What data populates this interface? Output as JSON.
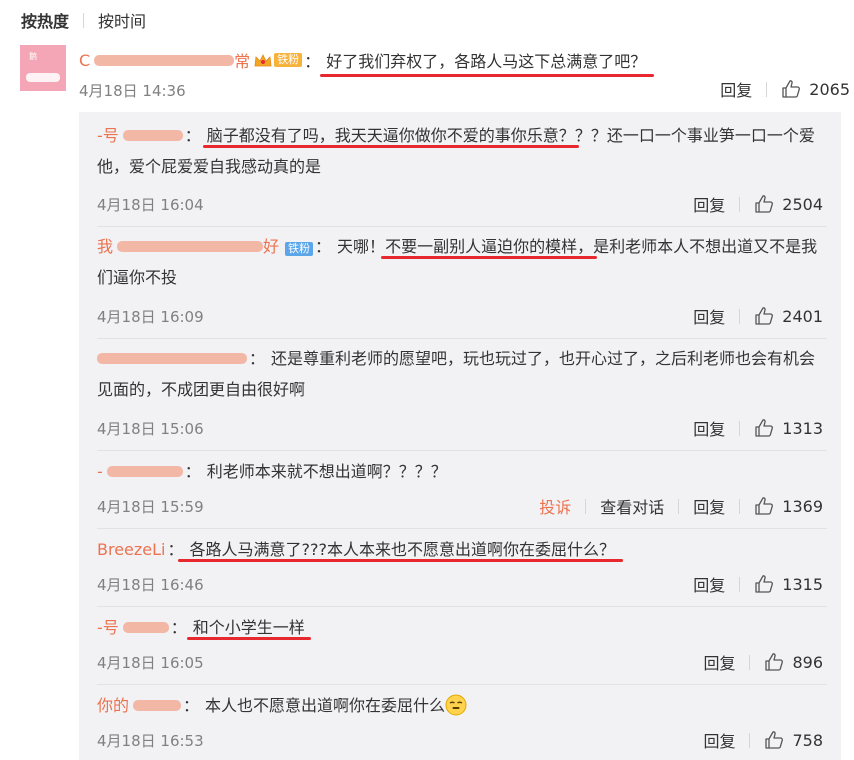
{
  "sort": {
    "hot": "按热度",
    "time": "按时间"
  },
  "main": {
    "avatar_text": "鹅",
    "username_visible_start": "C",
    "username_visible_end": "常",
    "badge": "铁粉",
    "text": "好了我们弃权了，各路人马这下总满意了吧？",
    "time": "4月18日 14:36",
    "reply_label": "回复",
    "likes": "2065"
  },
  "replies": [
    {
      "user_visible": "-号",
      "text_a": "脑子都没有了吗，我天天逼你做你不爱的事你乐意？",
      "text_b": "？？还一口一个事业笋一口一个爱他，爱个屁爱爱自我感动真的是",
      "time": "4月18日 16:04",
      "reply_label": "回复",
      "likes": "2504"
    },
    {
      "user_visible": "我",
      "user_end": "好",
      "badge": "铁粉",
      "text_pre": "天哪！",
      "text_u": "不要一副别人逼迫你的模样，",
      "text_post": "是利老师本人不想出道又不是我们逼你不投",
      "time": "4月18日 16:09",
      "reply_label": "回复",
      "likes": "2401"
    },
    {
      "user_visible": "",
      "text": "还是尊重利老师的愿望吧，玩也玩过了，也开心过了，之后利老师也会有机会见面的，不成团更自由很好啊",
      "time": "4月18日 15:06",
      "reply_label": "回复",
      "likes": "1313"
    },
    {
      "user_visible": "-",
      "text": "利老师本来就不想出道啊？？？？",
      "time": "4月18日 15:59",
      "report_label": "投诉",
      "view_label": "查看对话",
      "reply_label": "回复",
      "likes": "1369"
    },
    {
      "user_visible": "BreezeLi",
      "text": "各路人马满意了???本人本来也不愿意出道啊你在委屈什么？",
      "time": "4月18日 16:46",
      "reply_label": "回复",
      "likes": "1315"
    },
    {
      "user_visible": "-号",
      "text": "和个小学生一样",
      "time": "4月18日 16:05",
      "reply_label": "回复",
      "likes": "896"
    },
    {
      "user_visible": "你的",
      "text": "本人也不愿意出道啊你在委屈什么",
      "time": "4月18日 16:53",
      "reply_label": "回复",
      "likes": "758"
    }
  ],
  "colors": {
    "username": "#eb7350",
    "underline": "#e8282f",
    "badge": "#f7b23b",
    "badge_blue": "#5ba6e8",
    "reply_bg": "#f2f2f5"
  }
}
